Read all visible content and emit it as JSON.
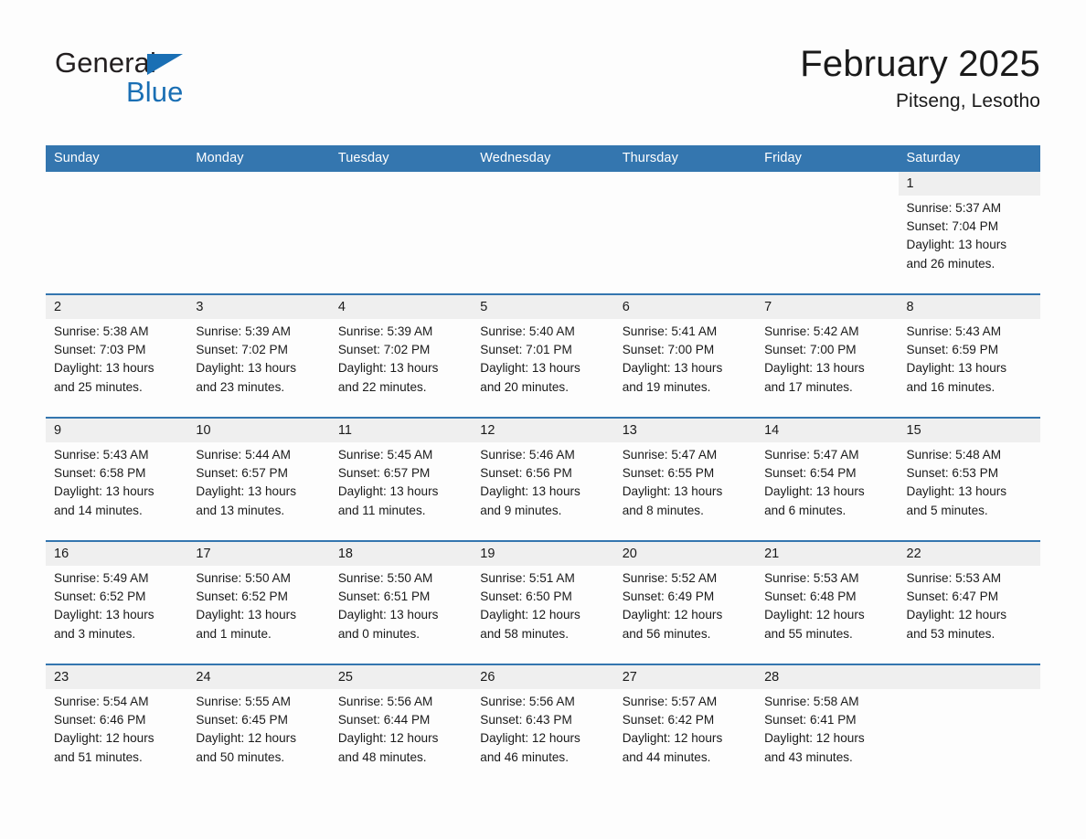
{
  "brand": {
    "line1": "General",
    "line2": "Blue",
    "triangle_icon": "blue-triangle-logo-mark",
    "accent_color": "#1a6fb4"
  },
  "header": {
    "title": "February 2025",
    "subtitle": "Pitseng, Lesotho"
  },
  "colors": {
    "header_row_blue": "#3476af",
    "date_band_gray": "#efefef",
    "page_background": "#fdfdfd",
    "text": "#1a1a1a"
  },
  "calendar": {
    "weekday_headers": [
      "Sunday",
      "Monday",
      "Tuesday",
      "Wednesday",
      "Thursday",
      "Friday",
      "Saturday"
    ],
    "labels": {
      "sunrise": "Sunrise:",
      "sunset": "Sunset:",
      "daylight": "Daylight:"
    },
    "weeks": [
      [
        {
          "blank": true
        },
        {
          "blank": true
        },
        {
          "blank": true
        },
        {
          "blank": true
        },
        {
          "blank": true
        },
        {
          "blank": true
        },
        {
          "date": "1",
          "sunrise": "Sunrise: 5:37 AM",
          "sunset": "Sunset: 7:04 PM",
          "daylight_line1": "Daylight: 13 hours",
          "daylight_line2": "and 26 minutes."
        }
      ],
      [
        {
          "date": "2",
          "sunrise": "Sunrise: 5:38 AM",
          "sunset": "Sunset: 7:03 PM",
          "daylight_line1": "Daylight: 13 hours",
          "daylight_line2": "and 25 minutes."
        },
        {
          "date": "3",
          "sunrise": "Sunrise: 5:39 AM",
          "sunset": "Sunset: 7:02 PM",
          "daylight_line1": "Daylight: 13 hours",
          "daylight_line2": "and 23 minutes."
        },
        {
          "date": "4",
          "sunrise": "Sunrise: 5:39 AM",
          "sunset": "Sunset: 7:02 PM",
          "daylight_line1": "Daylight: 13 hours",
          "daylight_line2": "and 22 minutes."
        },
        {
          "date": "5",
          "sunrise": "Sunrise: 5:40 AM",
          "sunset": "Sunset: 7:01 PM",
          "daylight_line1": "Daylight: 13 hours",
          "daylight_line2": "and 20 minutes."
        },
        {
          "date": "6",
          "sunrise": "Sunrise: 5:41 AM",
          "sunset": "Sunset: 7:00 PM",
          "daylight_line1": "Daylight: 13 hours",
          "daylight_line2": "and 19 minutes."
        },
        {
          "date": "7",
          "sunrise": "Sunrise: 5:42 AM",
          "sunset": "Sunset: 7:00 PM",
          "daylight_line1": "Daylight: 13 hours",
          "daylight_line2": "and 17 minutes."
        },
        {
          "date": "8",
          "sunrise": "Sunrise: 5:43 AM",
          "sunset": "Sunset: 6:59 PM",
          "daylight_line1": "Daylight: 13 hours",
          "daylight_line2": "and 16 minutes."
        }
      ],
      [
        {
          "date": "9",
          "sunrise": "Sunrise: 5:43 AM",
          "sunset": "Sunset: 6:58 PM",
          "daylight_line1": "Daylight: 13 hours",
          "daylight_line2": "and 14 minutes."
        },
        {
          "date": "10",
          "sunrise": "Sunrise: 5:44 AM",
          "sunset": "Sunset: 6:57 PM",
          "daylight_line1": "Daylight: 13 hours",
          "daylight_line2": "and 13 minutes."
        },
        {
          "date": "11",
          "sunrise": "Sunrise: 5:45 AM",
          "sunset": "Sunset: 6:57 PM",
          "daylight_line1": "Daylight: 13 hours",
          "daylight_line2": "and 11 minutes."
        },
        {
          "date": "12",
          "sunrise": "Sunrise: 5:46 AM",
          "sunset": "Sunset: 6:56 PM",
          "daylight_line1": "Daylight: 13 hours",
          "daylight_line2": "and 9 minutes."
        },
        {
          "date": "13",
          "sunrise": "Sunrise: 5:47 AM",
          "sunset": "Sunset: 6:55 PM",
          "daylight_line1": "Daylight: 13 hours",
          "daylight_line2": "and 8 minutes."
        },
        {
          "date": "14",
          "sunrise": "Sunrise: 5:47 AM",
          "sunset": "Sunset: 6:54 PM",
          "daylight_line1": "Daylight: 13 hours",
          "daylight_line2": "and 6 minutes."
        },
        {
          "date": "15",
          "sunrise": "Sunrise: 5:48 AM",
          "sunset": "Sunset: 6:53 PM",
          "daylight_line1": "Daylight: 13 hours",
          "daylight_line2": "and 5 minutes."
        }
      ],
      [
        {
          "date": "16",
          "sunrise": "Sunrise: 5:49 AM",
          "sunset": "Sunset: 6:52 PM",
          "daylight_line1": "Daylight: 13 hours",
          "daylight_line2": "and 3 minutes."
        },
        {
          "date": "17",
          "sunrise": "Sunrise: 5:50 AM",
          "sunset": "Sunset: 6:52 PM",
          "daylight_line1": "Daylight: 13 hours",
          "daylight_line2": "and 1 minute."
        },
        {
          "date": "18",
          "sunrise": "Sunrise: 5:50 AM",
          "sunset": "Sunset: 6:51 PM",
          "daylight_line1": "Daylight: 13 hours",
          "daylight_line2": "and 0 minutes."
        },
        {
          "date": "19",
          "sunrise": "Sunrise: 5:51 AM",
          "sunset": "Sunset: 6:50 PM",
          "daylight_line1": "Daylight: 12 hours",
          "daylight_line2": "and 58 minutes."
        },
        {
          "date": "20",
          "sunrise": "Sunrise: 5:52 AM",
          "sunset": "Sunset: 6:49 PM",
          "daylight_line1": "Daylight: 12 hours",
          "daylight_line2": "and 56 minutes."
        },
        {
          "date": "21",
          "sunrise": "Sunrise: 5:53 AM",
          "sunset": "Sunset: 6:48 PM",
          "daylight_line1": "Daylight: 12 hours",
          "daylight_line2": "and 55 minutes."
        },
        {
          "date": "22",
          "sunrise": "Sunrise: 5:53 AM",
          "sunset": "Sunset: 6:47 PM",
          "daylight_line1": "Daylight: 12 hours",
          "daylight_line2": "and 53 minutes."
        }
      ],
      [
        {
          "date": "23",
          "sunrise": "Sunrise: 5:54 AM",
          "sunset": "Sunset: 6:46 PM",
          "daylight_line1": "Daylight: 12 hours",
          "daylight_line2": "and 51 minutes."
        },
        {
          "date": "24",
          "sunrise": "Sunrise: 5:55 AM",
          "sunset": "Sunset: 6:45 PM",
          "daylight_line1": "Daylight: 12 hours",
          "daylight_line2": "and 50 minutes."
        },
        {
          "date": "25",
          "sunrise": "Sunrise: 5:56 AM",
          "sunset": "Sunset: 6:44 PM",
          "daylight_line1": "Daylight: 12 hours",
          "daylight_line2": "and 48 minutes."
        },
        {
          "date": "26",
          "sunrise": "Sunrise: 5:56 AM",
          "sunset": "Sunset: 6:43 PM",
          "daylight_line1": "Daylight: 12 hours",
          "daylight_line2": "and 46 minutes."
        },
        {
          "date": "27",
          "sunrise": "Sunrise: 5:57 AM",
          "sunset": "Sunset: 6:42 PM",
          "daylight_line1": "Daylight: 12 hours",
          "daylight_line2": "and 44 minutes."
        },
        {
          "date": "28",
          "sunrise": "Sunrise: 5:58 AM",
          "sunset": "Sunset: 6:41 PM",
          "daylight_line1": "Daylight: 12 hours",
          "daylight_line2": "and 43 minutes."
        },
        {
          "blank": true,
          "shaded": true
        }
      ]
    ]
  }
}
